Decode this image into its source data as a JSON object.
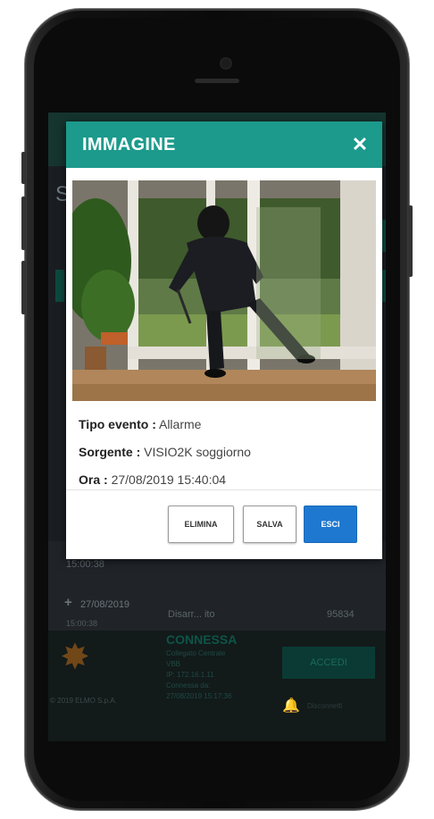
{
  "modal": {
    "title": "IMMAGINE",
    "close_label": "✕",
    "fields": {
      "event_type": {
        "label": "Tipo evento :",
        "value": "Allarme"
      },
      "source": {
        "label": "Sorgente :",
        "value": "VISIO2K soggiorno"
      },
      "time": {
        "label": "Ora :",
        "value": "27/08/2019 15:40:04"
      }
    },
    "buttons": {
      "delete": "ELIMINA",
      "save": "SALVA",
      "exit": "ESCI"
    }
  },
  "background_app": {
    "letter": "S",
    "rows": [
      {
        "time": "15:00:38"
      },
      {
        "date": "27/08/2019",
        "time": "15:00:38",
        "description": "Disarr... ito",
        "number": "95834"
      }
    ],
    "footer": {
      "connection_title": "CONNESSA",
      "connection_lines": [
        "Collegato Centrale",
        "VBB",
        "IP: 172.16.1.11",
        "Connessa da:",
        "27/08/2019 15:17:36"
      ],
      "login_button": "ACCEDI",
      "disconnect_label": "Disconnetti",
      "logo_text": "© 2019 ELMO S.p.A."
    }
  },
  "colors": {
    "header_teal": "#1c9a8c",
    "primary_blue": "#1f78d0"
  }
}
